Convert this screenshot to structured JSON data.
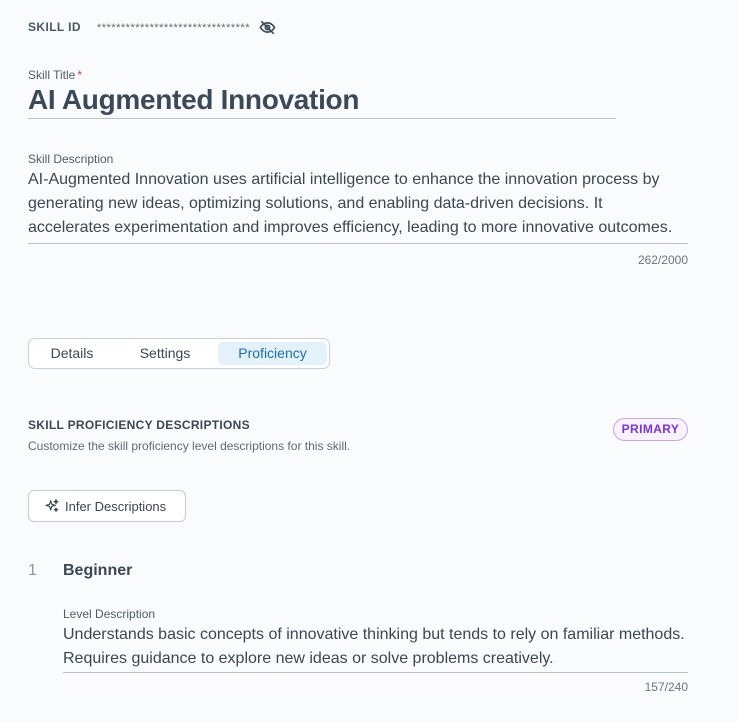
{
  "skill_id": {
    "label": "SKILL ID",
    "masked_value": "********************************",
    "visibility_icon": "eye-off-icon"
  },
  "title_field": {
    "label": "Skill Title",
    "required_marker": "*",
    "value": "AI Augmented Innovation"
  },
  "description_field": {
    "label": "Skill Description",
    "value": "AI-Augmented Innovation uses artificial intelligence to enhance the innovation process by generating new ideas, optimizing solutions, and enabling data-driven decisions. It accelerates experimentation and improves efficiency, leading to more innovative outcomes.",
    "char_count": "262/2000"
  },
  "tabs": [
    {
      "label": "Details",
      "active": false
    },
    {
      "label": "Settings",
      "active": false
    },
    {
      "label": "Proficiency",
      "active": true
    }
  ],
  "proficiency": {
    "title": "SKILL PROFICIENCY DESCRIPTIONS",
    "subtitle": "Customize the skill proficiency level descriptions for this skill.",
    "badge": "PRIMARY",
    "infer_button": {
      "label": "Infer Descriptions",
      "icon": "sparkle-icon"
    },
    "levels": [
      {
        "number": "1",
        "name": "Beginner",
        "description_label": "Level Description",
        "description": "Understands basic concepts of innovative thinking but tends to rely on familiar methods. Requires guidance to explore new ideas or solve problems creatively.",
        "char_count": "157/240"
      }
    ]
  },
  "colors": {
    "background": "#fafbfc",
    "text": "#3b4753",
    "active_tab_bg": "#e3f1fb",
    "active_tab_text": "#1b6fb0",
    "badge_text": "#7a35d6",
    "badge_border": "#c4a6ee",
    "required": "#d23a4b"
  }
}
